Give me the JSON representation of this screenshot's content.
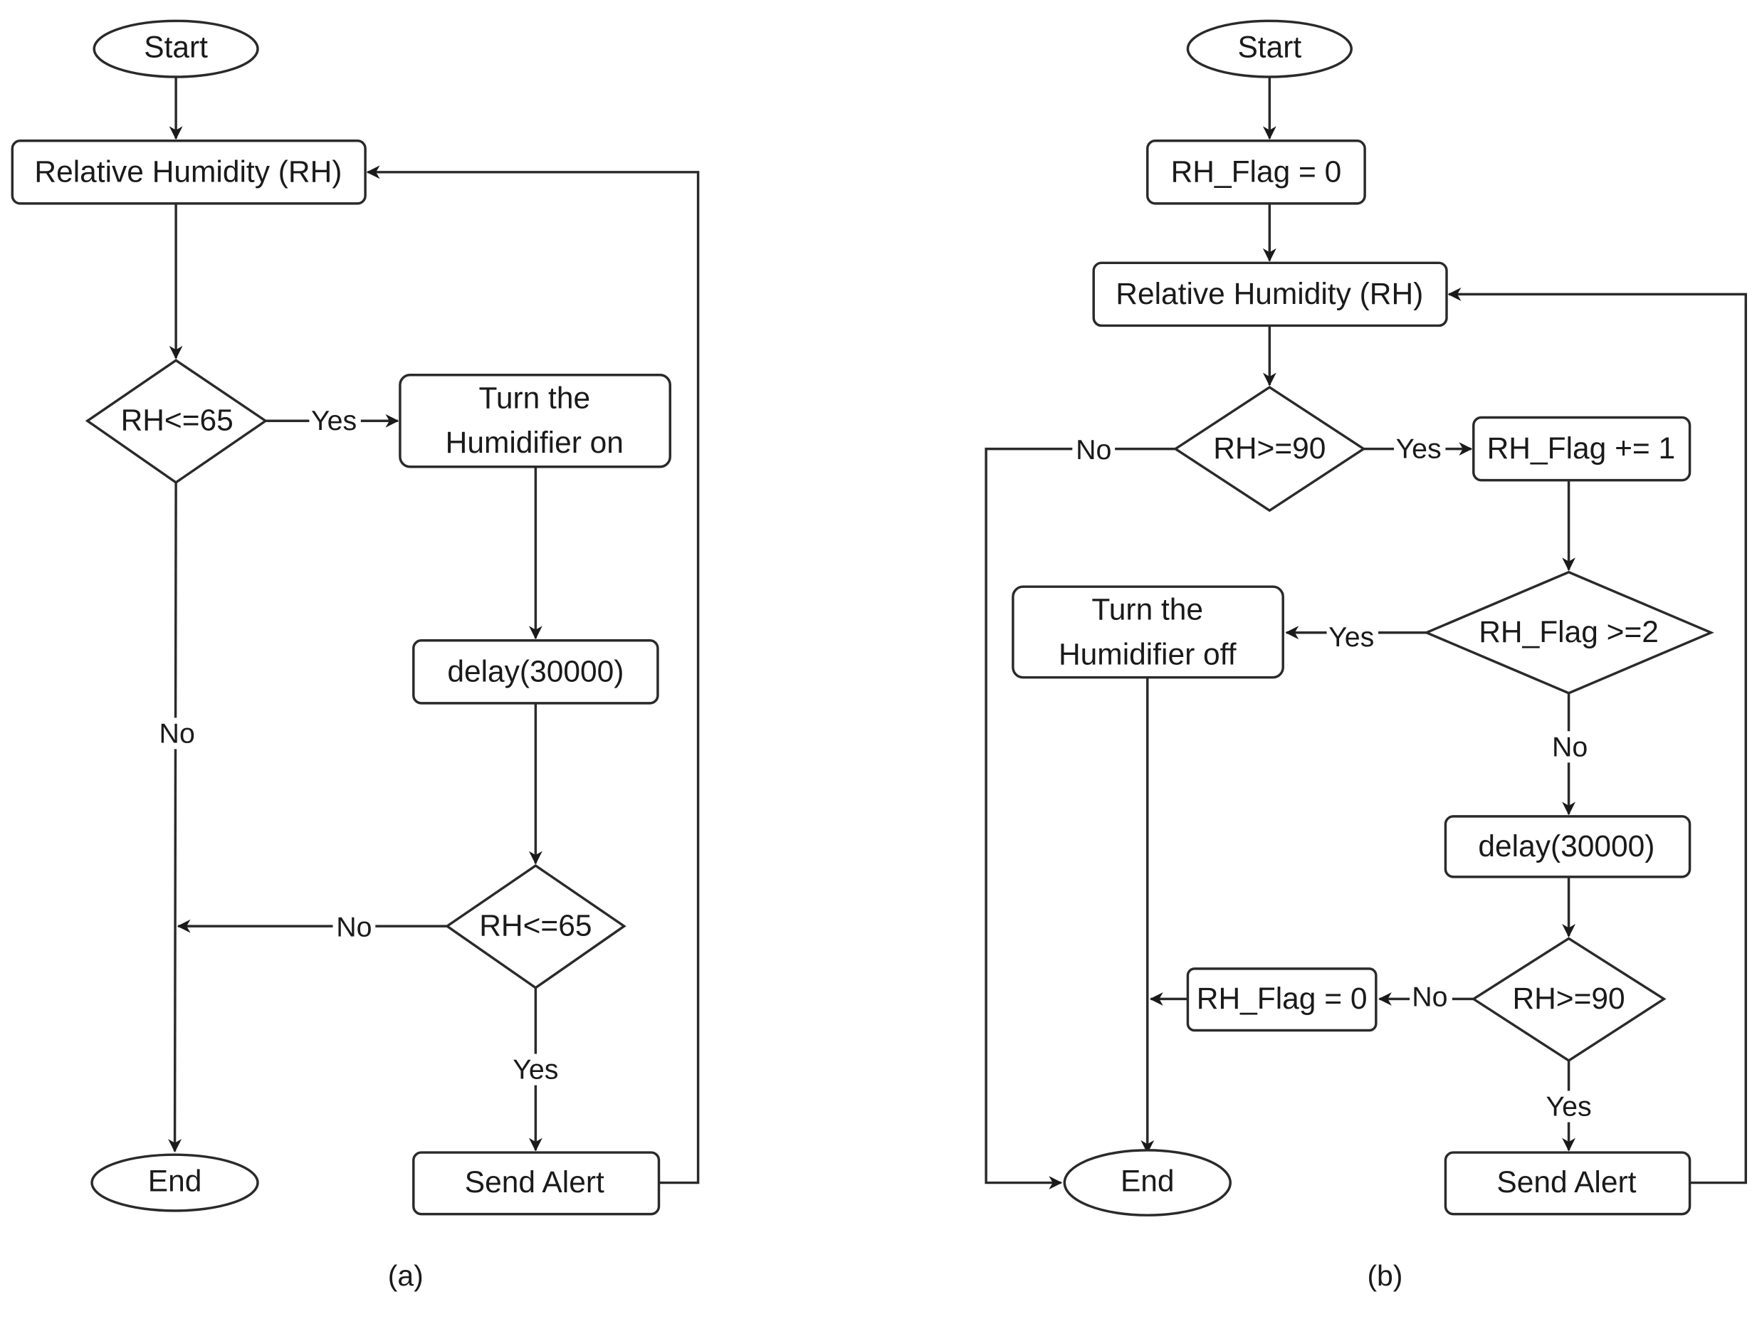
{
  "panel_a": {
    "caption": "(a)",
    "start": "Start",
    "read_rh": "Relative Humidity (RH)",
    "decision1": "RH<=65",
    "humidifier_on_line1": "Turn the",
    "humidifier_on_line2": "Humidifier on",
    "delay": "delay(30000)",
    "decision2": "RH<=65",
    "send_alert": "Send Alert",
    "end": "End",
    "edge_yes_1": "Yes",
    "edge_no_1": "No",
    "edge_no_2": "No",
    "edge_yes_2": "Yes"
  },
  "panel_b": {
    "caption": "(b)",
    "start": "Start",
    "init_flag": "RH_Flag = 0",
    "read_rh": "Relative Humidity (RH)",
    "decision1": "RH>=90",
    "increment_flag": "RH_Flag += 1",
    "decision_flag": "RH_Flag >=2",
    "humidifier_off_line1": "Turn the",
    "humidifier_off_line2": "Humidifier off",
    "delay": "delay(30000)",
    "decision2": "RH>=90",
    "reset_flag": "RH_Flag = 0",
    "send_alert": "Send Alert",
    "end": "End",
    "edge_no_1": "No",
    "edge_yes_1": "Yes",
    "edge_yes_flag": "Yes",
    "edge_no_flag": "No",
    "edge_no_2": "No",
    "edge_yes_2": "Yes"
  }
}
